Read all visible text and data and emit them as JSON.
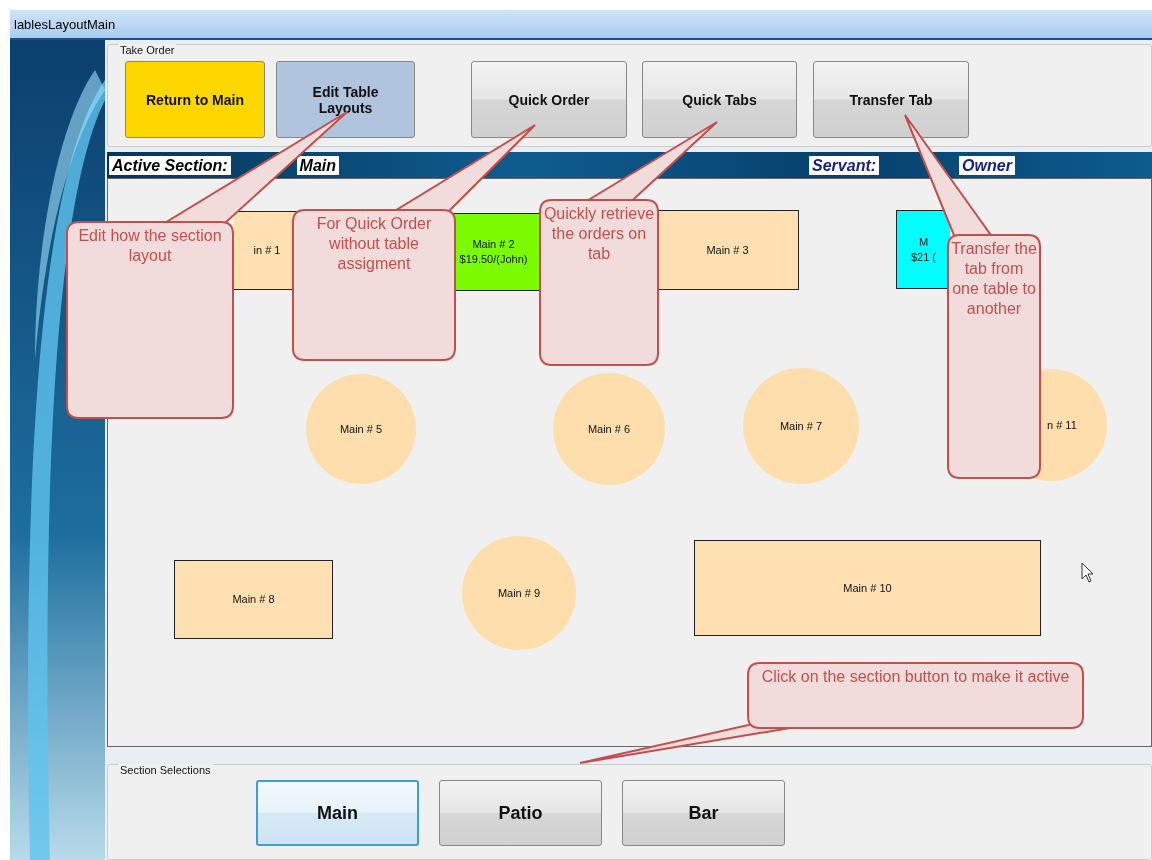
{
  "window": {
    "title": "lablesLayoutMain"
  },
  "take_order": {
    "label": "Take Order",
    "buttons": [
      {
        "label": "Return to Main",
        "kind": "flat",
        "color": "#ffd700"
      },
      {
        "label": "Edit Table Layouts",
        "kind": "flat",
        "color": "#b0c4de"
      },
      {
        "label": "Quick Order",
        "kind": "glossy"
      },
      {
        "label": "Quick Tabs",
        "kind": "glossy"
      },
      {
        "label": "Transfer Tab",
        "kind": "glossy"
      }
    ]
  },
  "section_bar": {
    "active_label": "Active Section:",
    "active_value": "Main",
    "servant_label": "Servant:",
    "servant_value": "Owner"
  },
  "tables": [
    {
      "kind": "rect",
      "color": "#ffe0b2",
      "lines": [
        "in # 1"
      ]
    },
    {
      "kind": "rect",
      "color": "#7cfc00",
      "lines": [
        "Main # 2",
        "$19.50/(John)"
      ]
    },
    {
      "kind": "rect",
      "color": "#ffe0b2",
      "lines": [
        "Main # 3"
      ]
    },
    {
      "kind": "rect",
      "color": "#00ffff",
      "lines": [
        "M",
        "$21 ("
      ]
    },
    {
      "kind": "round",
      "color": "#ffdead",
      "lines": [
        "Main # 5"
      ]
    },
    {
      "kind": "round",
      "color": "#ffdead",
      "lines": [
        "Main # 6"
      ]
    },
    {
      "kind": "round",
      "color": "#ffdead",
      "lines": [
        "Main # 7"
      ]
    },
    {
      "kind": "round",
      "color": "#ffdead",
      "lines": [
        "n # 11"
      ]
    },
    {
      "kind": "rect",
      "color": "#ffe0b2",
      "lines": [
        "Main # 8"
      ]
    },
    {
      "kind": "round",
      "color": "#ffdead",
      "lines": [
        "Main # 9"
      ]
    },
    {
      "kind": "rect",
      "color": "#ffe0b2",
      "lines": [
        "Main # 10"
      ]
    }
  ],
  "callouts": [
    "Edit how the section layout",
    "For Quick Order without table assigment",
    "Quickly retrieve the orders on tab",
    "Transfer the tab from one table to another",
    "Click on the section button to make it active"
  ],
  "section_selections": {
    "label": "Section Selections",
    "buttons": [
      {
        "label": "Main",
        "selected": true
      },
      {
        "label": "Patio",
        "selected": false
      },
      {
        "label": "Bar",
        "selected": false
      }
    ]
  }
}
